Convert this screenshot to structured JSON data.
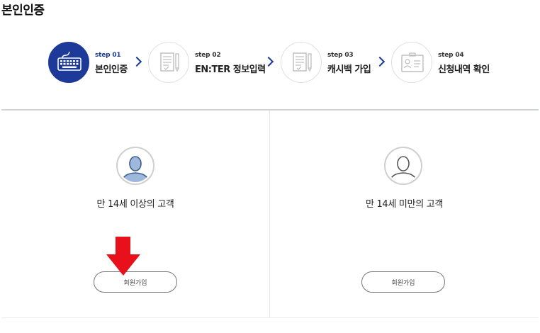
{
  "page_title": "본인인증",
  "steps": [
    {
      "num": "step 01",
      "name": "본인인증",
      "icon": "keyboard-icon",
      "active": true
    },
    {
      "num": "step 02",
      "name": "EN:TER 정보입력",
      "icon": "form-pen-icon",
      "active": false
    },
    {
      "num": "step 03",
      "name": "캐시백 가입",
      "icon": "form-pen-icon",
      "active": false
    },
    {
      "num": "step 04",
      "name": "신청내역 확인",
      "icon": "id-card-icon",
      "active": false
    }
  ],
  "panels": {
    "adult": {
      "label": "만 14세 이상의 고객",
      "button": "회원가입"
    },
    "minor": {
      "label": "만 14세 미만의 고객",
      "button": "회원가입"
    }
  },
  "colors": {
    "accent": "#1d3a99",
    "annotation_arrow": "#e8101a"
  }
}
